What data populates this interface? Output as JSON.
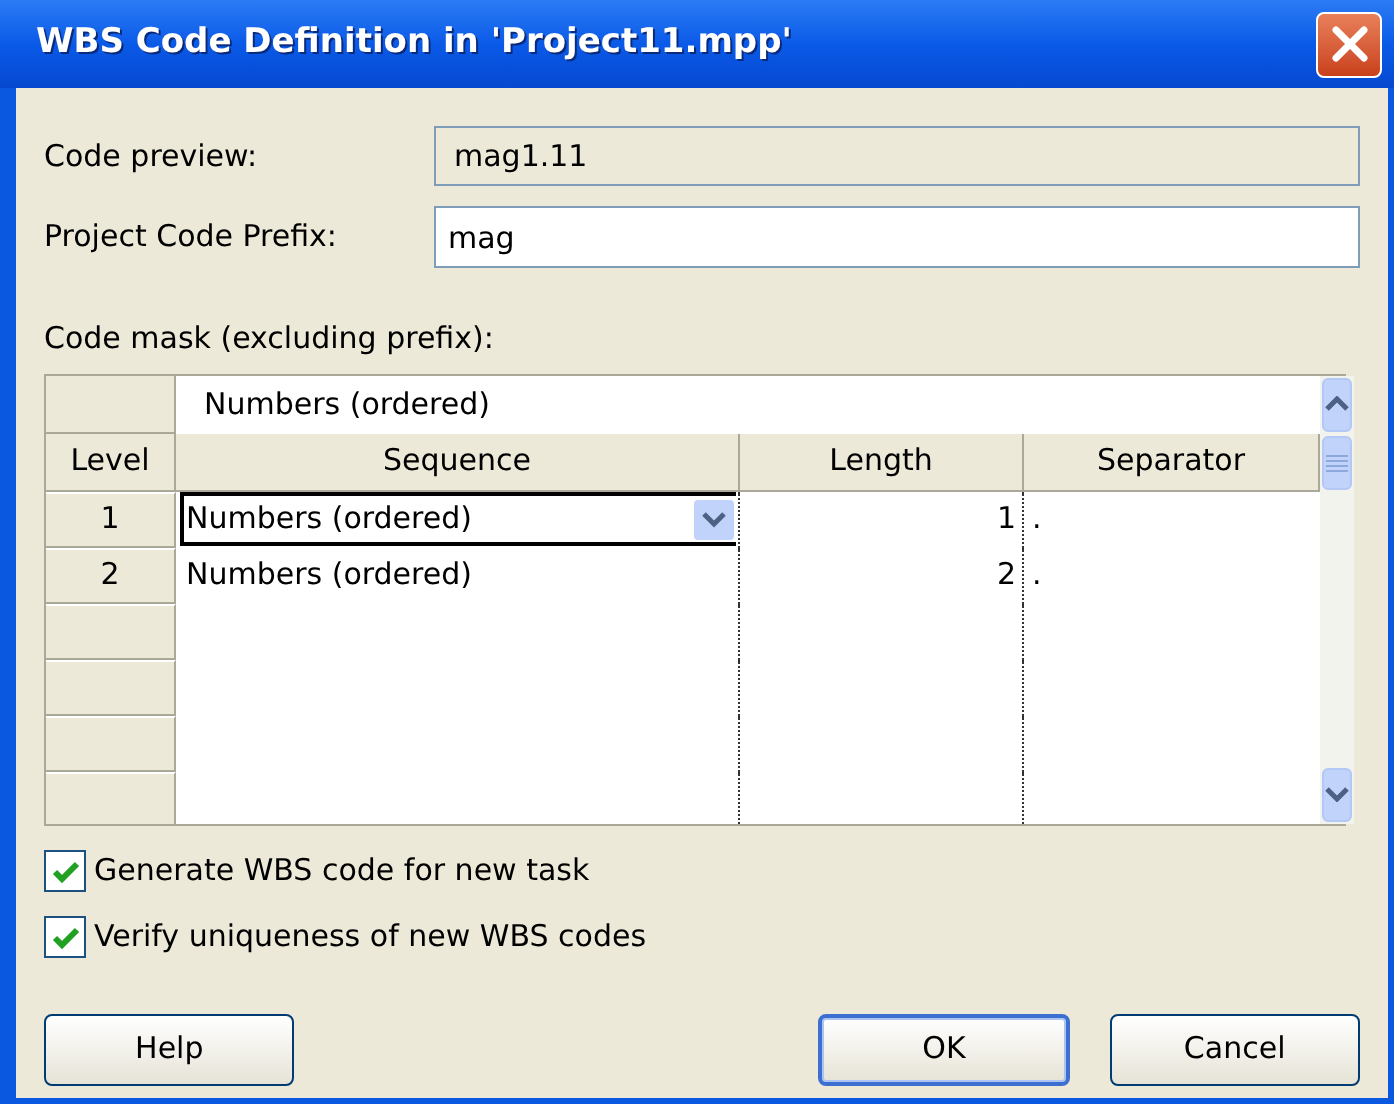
{
  "window": {
    "title": "WBS Code Definition in 'Project11.mpp'"
  },
  "code_preview": {
    "label": "Code preview:",
    "value": "mag1.11"
  },
  "project_code_prefix": {
    "label": "Project Code Prefix:",
    "value": "mag"
  },
  "code_mask": {
    "label": "Code mask (excluding prefix):",
    "edit_value": "Numbers (ordered)",
    "columns": [
      "Level",
      "Sequence",
      "Length",
      "Separator"
    ],
    "rows": [
      {
        "level": "1",
        "sequence": "Numbers (ordered)",
        "length": "1",
        "separator": ".",
        "selected": true
      },
      {
        "level": "2",
        "sequence": "Numbers (ordered)",
        "length": "2",
        "separator": ".",
        "selected": false
      }
    ]
  },
  "options": [
    {
      "label": "Generate WBS code for new task",
      "checked": true
    },
    {
      "label": "Verify uniqueness of new WBS codes",
      "checked": true
    }
  ],
  "buttons": [
    {
      "label": "Help",
      "default": false
    },
    {
      "label": "OK",
      "default": true
    },
    {
      "label": "Cancel",
      "default": false
    }
  ]
}
